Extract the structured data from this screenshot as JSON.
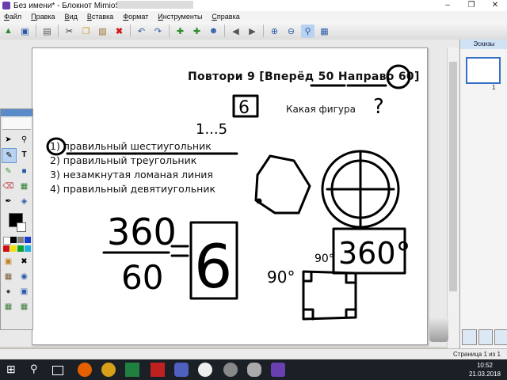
{
  "window": {
    "title": "Без имени* - Блокнот MimioStudio",
    "buttons": [
      "–",
      "❐",
      "✕"
    ]
  },
  "menu": [
    "Файл",
    "Правка",
    "Вид",
    "Вставка",
    "Формат",
    "Инструменты",
    "Справка"
  ],
  "slide": {
    "heading": "Повтори 9 [Вперёд 50 Направо 60]",
    "question": "Какая фигура",
    "options": [
      "1) правильный шестиугольник",
      "2) правильный треугольник",
      "3) незамкнутая ломаная линия",
      "4) правильный девятиугольник"
    ]
  },
  "handwriting": {
    "boxed_six": "6",
    "range": "1...5",
    "question_mark": "?",
    "numerator": "360",
    "denominator": "60",
    "result": "6",
    "angle_boxed": "360°",
    "angle_left": "90°",
    "angle_inner": "90°"
  },
  "right_panel": {
    "header": "Эскизы",
    "thumb_number": "1"
  },
  "status": {
    "page": "Страница 1 из 1"
  },
  "clock": {
    "time": "10:52",
    "date": "21.03.2018"
  },
  "colors": {
    "accent": "#3470c8",
    "ink": "#000000"
  }
}
